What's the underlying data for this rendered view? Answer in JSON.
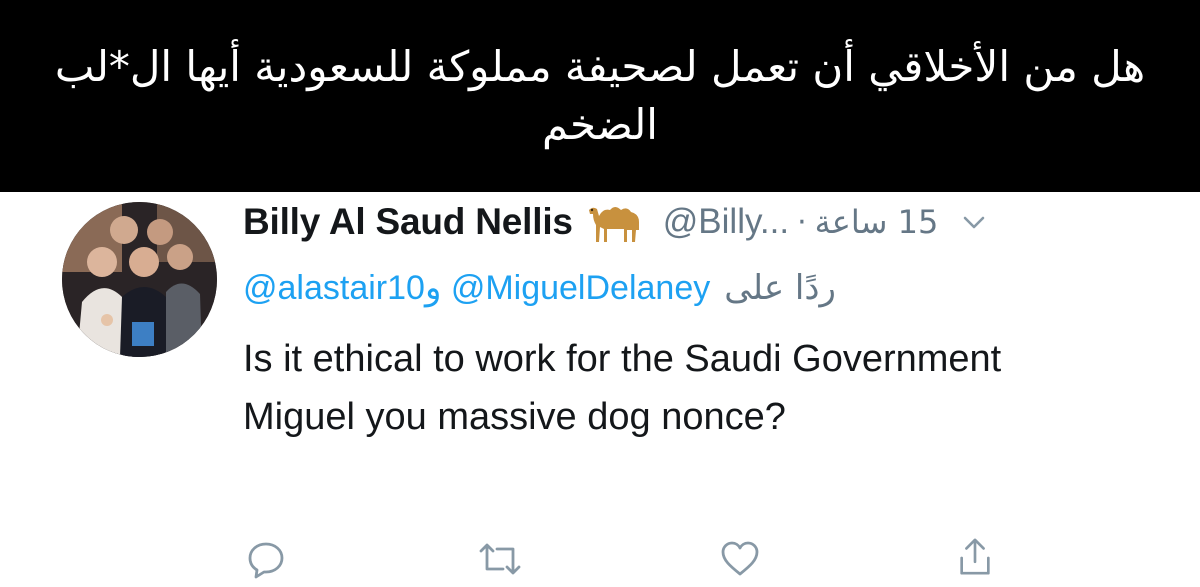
{
  "caption": {
    "text": "هل من الأخلاقي أن تعمل لصحيفة مملوكة للسعودية أيها ال*لب الضخم"
  },
  "tweet": {
    "display_name": "Billy Al Saud Nellis",
    "name_emoji": "camel-icon",
    "handle": "@Billy...",
    "separator": "·",
    "time": "15 ساعة",
    "reply_prefix": "ردًا على",
    "reply_mention_1": "@MiguelDelaney",
    "reply_and": "و",
    "reply_mention_2": "@alastair10",
    "text": "Is it ethical to work for the Saudi Government Miguel you massive dog nonce?"
  },
  "actions": [
    {
      "icon": "reply-icon"
    },
    {
      "icon": "retweet-icon"
    },
    {
      "icon": "like-icon"
    },
    {
      "icon": "share-icon"
    }
  ],
  "colors": {
    "caption_bg": "#000000",
    "caption_text": "#ffffff",
    "link": "#1da1f2",
    "secondary": "#657786",
    "primary_text": "#14171a"
  }
}
